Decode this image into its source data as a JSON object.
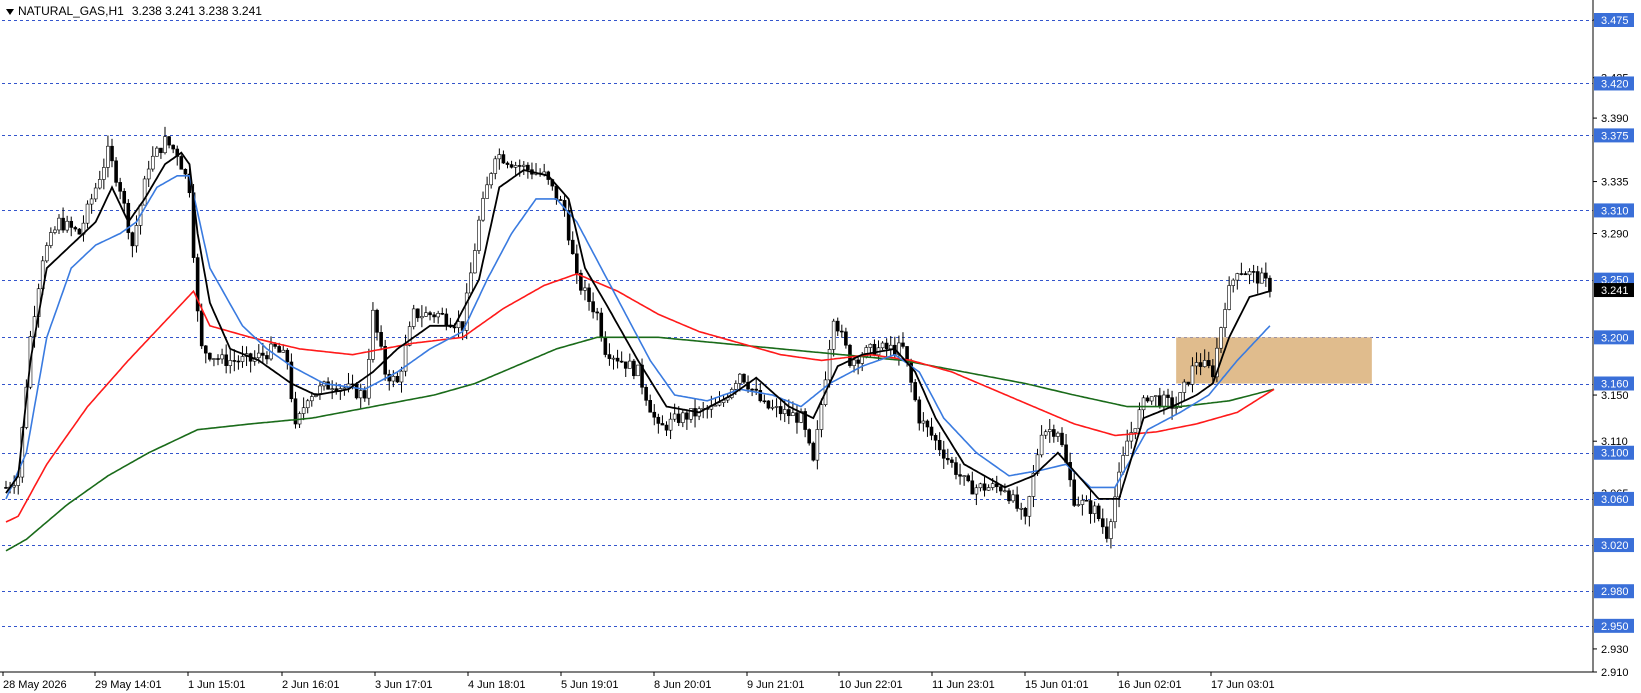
{
  "header": {
    "symbol": "NATURAL_GAS,H1",
    "ohlc": "3.238 3.241 3.238 3.241"
  },
  "colors": {
    "level_line": "#3355cc",
    "level_box": "#3a6fd8",
    "zone": "#deb887",
    "ma_fast": "#000000",
    "ma_blue": "#3a7be0",
    "ma_red": "#ff1a1a",
    "ma_green": "#1a6b1a",
    "current_box": "#000000"
  },
  "chart_data": {
    "type": "candlestick",
    "title": "NATURAL_GAS,H1",
    "ylim": [
      2.905,
      3.48
    ],
    "x_labels": [
      "28 May 2026",
      "29 May 14:01",
      "1 Jun 15:01",
      "2 Jun 16:01",
      "3 Jun 17:01",
      "4 Jun 18:01",
      "5 Jun 19:01",
      "8 Jun 20:01",
      "9 Jun 21:01",
      "10 Jun 22:01",
      "11 Jun 23:01",
      "15 Jun 01:01",
      "16 Jun 02:01",
      "17 Jun 03:01"
    ],
    "levels": [
      "3.475",
      "3.420",
      "3.375",
      "3.310",
      "3.250",
      "3.200",
      "3.160",
      "3.100",
      "3.060",
      "3.020",
      "2.980",
      "2.950"
    ],
    "y_ticks": [
      "3.475",
      "3.425",
      "3.390",
      "3.335",
      "3.290",
      "3.150",
      "3.110",
      "3.065",
      "2.930",
      "2.910"
    ],
    "current_price": "3.241",
    "zone": {
      "from": 3.16,
      "to": 3.2,
      "start_bar": 287,
      "end_bar": 335
    },
    "bars": 300,
    "close_path": [
      [
        0,
        3.07
      ],
      [
        3,
        3.08
      ],
      [
        6,
        3.2
      ],
      [
        9,
        3.27
      ],
      [
        13,
        3.3
      ],
      [
        18,
        3.29
      ],
      [
        22,
        3.33
      ],
      [
        25,
        3.36
      ],
      [
        28,
        3.33
      ],
      [
        31,
        3.28
      ],
      [
        35,
        3.35
      ],
      [
        39,
        3.37
      ],
      [
        42,
        3.36
      ],
      [
        45,
        3.33
      ],
      [
        47,
        3.22
      ],
      [
        48,
        3.19
      ],
      [
        53,
        3.18
      ],
      [
        60,
        3.18
      ],
      [
        66,
        3.19
      ],
      [
        69,
        3.18
      ],
      [
        71,
        3.12
      ],
      [
        74,
        3.15
      ],
      [
        80,
        3.16
      ],
      [
        88,
        3.15
      ],
      [
        90,
        3.22
      ],
      [
        93,
        3.17
      ],
      [
        96,
        3.16
      ],
      [
        100,
        3.22
      ],
      [
        106,
        3.22
      ],
      [
        112,
        3.21
      ],
      [
        116,
        3.3
      ],
      [
        120,
        3.36
      ],
      [
        125,
        3.35
      ],
      [
        132,
        3.34
      ],
      [
        137,
        3.31
      ],
      [
        140,
        3.25
      ],
      [
        145,
        3.22
      ],
      [
        147,
        3.19
      ],
      [
        155,
        3.17
      ],
      [
        160,
        3.12
      ],
      [
        165,
        3.13
      ],
      [
        175,
        3.14
      ],
      [
        180,
        3.17
      ],
      [
        186,
        3.14
      ],
      [
        195,
        3.13
      ],
      [
        198,
        3.09
      ],
      [
        203,
        3.22
      ],
      [
        207,
        3.18
      ],
      [
        213,
        3.19
      ],
      [
        220,
        3.19
      ],
      [
        224,
        3.13
      ],
      [
        230,
        3.1
      ],
      [
        236,
        3.07
      ],
      [
        245,
        3.07
      ],
      [
        250,
        3.04
      ],
      [
        254,
        3.12
      ],
      [
        258,
        3.12
      ],
      [
        262,
        3.06
      ],
      [
        267,
        3.05
      ],
      [
        270,
        3.03
      ],
      [
        275,
        3.11
      ],
      [
        280,
        3.15
      ],
      [
        287,
        3.14
      ],
      [
        292,
        3.18
      ],
      [
        296,
        3.17
      ],
      [
        299,
        3.23
      ],
      [
        302,
        3.26
      ],
      [
        308,
        3.25
      ],
      [
        311,
        3.241
      ]
    ],
    "ma_fast": [
      [
        0,
        3.065
      ],
      [
        3,
        3.08
      ],
      [
        6,
        3.18
      ],
      [
        10,
        3.26
      ],
      [
        16,
        3.28
      ],
      [
        22,
        3.3
      ],
      [
        26,
        3.33
      ],
      [
        30,
        3.3
      ],
      [
        34,
        3.32
      ],
      [
        39,
        3.35
      ],
      [
        43,
        3.36
      ],
      [
        45,
        3.35
      ],
      [
        47,
        3.29
      ],
      [
        50,
        3.23
      ],
      [
        55,
        3.19
      ],
      [
        62,
        3.18
      ],
      [
        70,
        3.16
      ],
      [
        76,
        3.15
      ],
      [
        84,
        3.155
      ],
      [
        90,
        3.17
      ],
      [
        96,
        3.19
      ],
      [
        104,
        3.21
      ],
      [
        110,
        3.21
      ],
      [
        116,
        3.25
      ],
      [
        121,
        3.33
      ],
      [
        127,
        3.345
      ],
      [
        133,
        3.34
      ],
      [
        138,
        3.32
      ],
      [
        142,
        3.26
      ],
      [
        147,
        3.23
      ],
      [
        155,
        3.18
      ],
      [
        162,
        3.14
      ],
      [
        170,
        3.135
      ],
      [
        178,
        3.15
      ],
      [
        184,
        3.165
      ],
      [
        192,
        3.14
      ],
      [
        198,
        3.13
      ],
      [
        204,
        3.175
      ],
      [
        210,
        3.185
      ],
      [
        218,
        3.19
      ],
      [
        223,
        3.17
      ],
      [
        228,
        3.13
      ],
      [
        235,
        3.09
      ],
      [
        245,
        3.07
      ],
      [
        252,
        3.08
      ],
      [
        258,
        3.1
      ],
      [
        263,
        3.08
      ],
      [
        268,
        3.06
      ],
      [
        273,
        3.06
      ],
      [
        279,
        3.13
      ],
      [
        286,
        3.14
      ],
      [
        292,
        3.15
      ],
      [
        296,
        3.16
      ],
      [
        300,
        3.2
      ],
      [
        305,
        3.235
      ],
      [
        310,
        3.24
      ]
    ],
    "ma_blue": [
      [
        0,
        3.06
      ],
      [
        5,
        3.1
      ],
      [
        10,
        3.2
      ],
      [
        16,
        3.26
      ],
      [
        22,
        3.28
      ],
      [
        28,
        3.29
      ],
      [
        32,
        3.3
      ],
      [
        37,
        3.33
      ],
      [
        42,
        3.34
      ],
      [
        45,
        3.34
      ],
      [
        50,
        3.26
      ],
      [
        58,
        3.21
      ],
      [
        64,
        3.19
      ],
      [
        70,
        3.175
      ],
      [
        78,
        3.16
      ],
      [
        88,
        3.155
      ],
      [
        96,
        3.17
      ],
      [
        104,
        3.19
      ],
      [
        112,
        3.205
      ],
      [
        118,
        3.25
      ],
      [
        124,
        3.29
      ],
      [
        130,
        3.32
      ],
      [
        135,
        3.32
      ],
      [
        140,
        3.3
      ],
      [
        146,
        3.26
      ],
      [
        152,
        3.22
      ],
      [
        158,
        3.18
      ],
      [
        164,
        3.15
      ],
      [
        172,
        3.145
      ],
      [
        180,
        3.155
      ],
      [
        188,
        3.15
      ],
      [
        195,
        3.14
      ],
      [
        202,
        3.16
      ],
      [
        210,
        3.175
      ],
      [
        218,
        3.185
      ],
      [
        224,
        3.17
      ],
      [
        230,
        3.13
      ],
      [
        238,
        3.1
      ],
      [
        246,
        3.08
      ],
      [
        254,
        3.085
      ],
      [
        260,
        3.09
      ],
      [
        266,
        3.07
      ],
      [
        272,
        3.07
      ],
      [
        280,
        3.12
      ],
      [
        288,
        3.135
      ],
      [
        295,
        3.15
      ],
      [
        302,
        3.18
      ],
      [
        310,
        3.21
      ]
    ],
    "ma_red": [
      [
        0,
        3.04
      ],
      [
        3,
        3.045
      ],
      [
        10,
        3.09
      ],
      [
        20,
        3.14
      ],
      [
        30,
        3.18
      ],
      [
        38,
        3.21
      ],
      [
        46,
        3.24
      ],
      [
        50,
        3.21
      ],
      [
        60,
        3.2
      ],
      [
        72,
        3.19
      ],
      [
        85,
        3.185
      ],
      [
        100,
        3.195
      ],
      [
        112,
        3.2
      ],
      [
        122,
        3.225
      ],
      [
        132,
        3.245
      ],
      [
        140,
        3.255
      ],
      [
        150,
        3.24
      ],
      [
        160,
        3.22
      ],
      [
        170,
        3.205
      ],
      [
        180,
        3.195
      ],
      [
        190,
        3.185
      ],
      [
        200,
        3.18
      ],
      [
        212,
        3.185
      ],
      [
        222,
        3.18
      ],
      [
        232,
        3.17
      ],
      [
        242,
        3.155
      ],
      [
        252,
        3.14
      ],
      [
        262,
        3.125
      ],
      [
        272,
        3.115
      ],
      [
        282,
        3.118
      ],
      [
        292,
        3.125
      ],
      [
        302,
        3.135
      ],
      [
        311,
        3.155
      ]
    ],
    "ma_green": [
      [
        0,
        3.015
      ],
      [
        5,
        3.025
      ],
      [
        15,
        3.055
      ],
      [
        25,
        3.08
      ],
      [
        35,
        3.1
      ],
      [
        47,
        3.12
      ],
      [
        60,
        3.125
      ],
      [
        75,
        3.13
      ],
      [
        90,
        3.14
      ],
      [
        105,
        3.15
      ],
      [
        115,
        3.16
      ],
      [
        125,
        3.175
      ],
      [
        135,
        3.19
      ],
      [
        145,
        3.2
      ],
      [
        160,
        3.2
      ],
      [
        175,
        3.195
      ],
      [
        190,
        3.19
      ],
      [
        205,
        3.185
      ],
      [
        220,
        3.18
      ],
      [
        235,
        3.17
      ],
      [
        250,
        3.16
      ],
      [
        262,
        3.15
      ],
      [
        275,
        3.14
      ],
      [
        288,
        3.14
      ],
      [
        300,
        3.145
      ],
      [
        311,
        3.155
      ]
    ]
  }
}
